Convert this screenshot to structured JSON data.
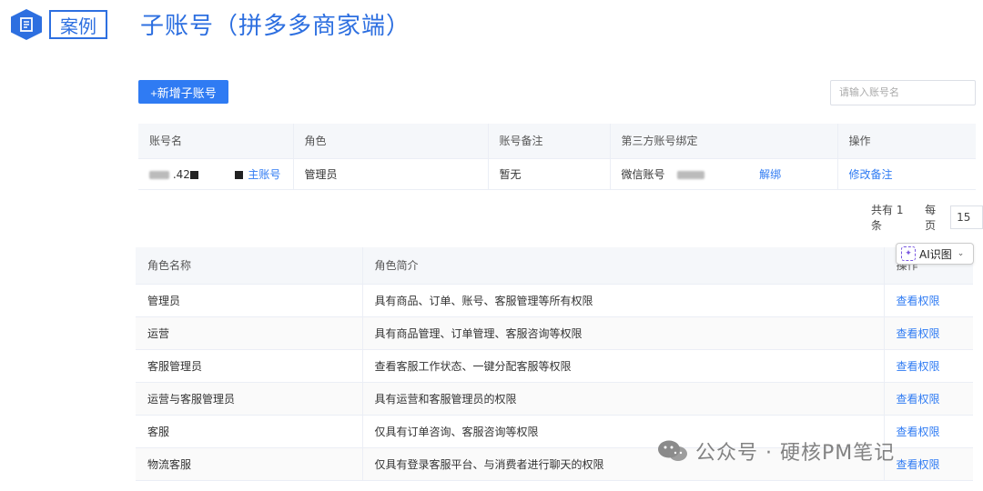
{
  "header": {
    "badge_label": "案例",
    "title": "子账号（拼多多商家端）"
  },
  "toolbar": {
    "add_label": "+新增子账号",
    "search_placeholder": "请输入账号名"
  },
  "accounts": {
    "columns": [
      "账号名",
      "角色",
      "账号备注",
      "第三方账号绑定",
      "操作"
    ],
    "rows": [
      {
        "name_visible": ".42",
        "name_tag": "主账号",
        "role": "管理员",
        "remark": "暂无",
        "bind_label": "微信账号",
        "unbind": "解绑",
        "action": "修改备注"
      }
    ]
  },
  "pager": {
    "total": "共有 1 条",
    "per_page_label": "每页",
    "per_page": "15"
  },
  "roles": {
    "columns": [
      "角色名称",
      "角色简介",
      "操作"
    ],
    "rows": [
      {
        "name": "管理员",
        "desc": "具有商品、订单、账号、客服管理等所有权限",
        "action": "查看权限"
      },
      {
        "name": "运营",
        "desc": "具有商品管理、订单管理、客服咨询等权限",
        "action": "查看权限"
      },
      {
        "name": "客服管理员",
        "desc": "查看客服工作状态、一键分配客服等权限",
        "action": "查看权限"
      },
      {
        "name": "运营与客服管理员",
        "desc": "具有运营和客服管理员的权限",
        "action": "查看权限"
      },
      {
        "name": "客服",
        "desc": "仅具有订单咨询、客服咨询等权限",
        "action": "查看权限"
      },
      {
        "name": "物流客服",
        "desc": "仅具有登录客服平台、与消费者进行聊天的权限",
        "action": "查看权限"
      }
    ]
  },
  "ai_chip": {
    "label": "AI识图"
  },
  "watermark": {
    "text": "公众号 · 硬核PM笔记"
  },
  "colors": {
    "accent": "#2f7bf3",
    "brand": "#2d6fe0"
  }
}
